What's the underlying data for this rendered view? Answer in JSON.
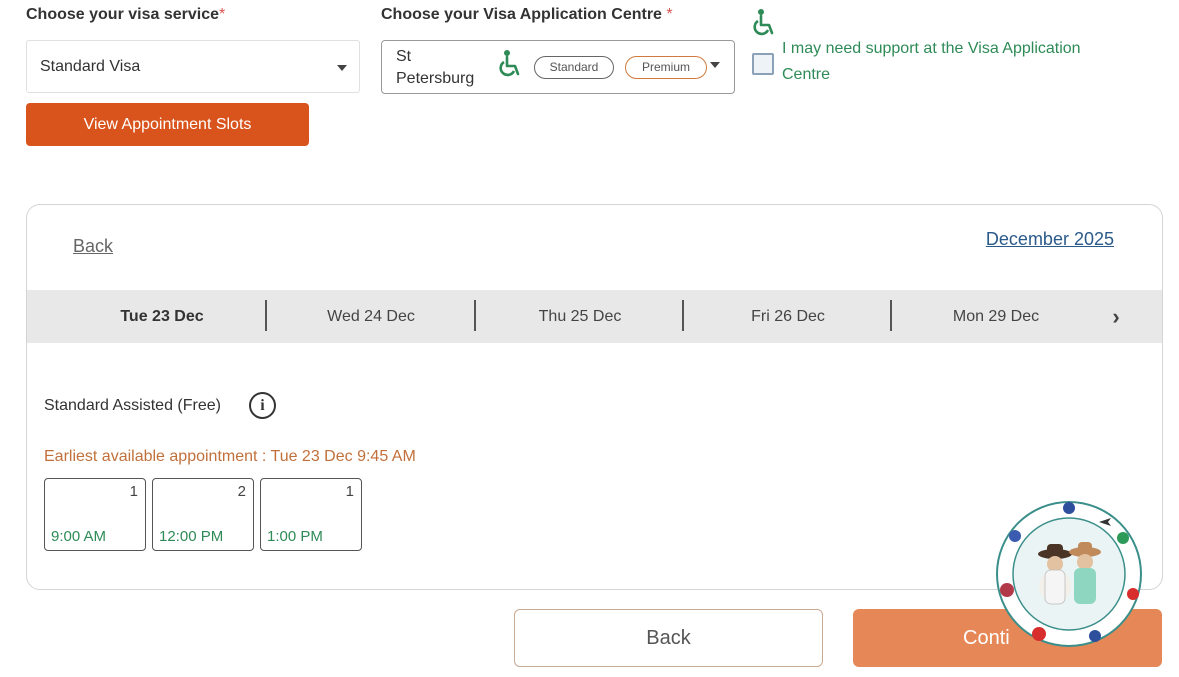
{
  "form": {
    "visa_label": "Choose your visa service",
    "visa_required": "*",
    "visa_value": "Standard Visa",
    "centre_label": "Choose your Visa Application Centre",
    "centre_required": "*",
    "centre_value": "St Petersburg",
    "pill_standard": "Standard",
    "pill_premium": "Premium",
    "support_text": "I may need support at the Visa Application Centre",
    "support_checked": false,
    "view_slots_label": "View Appointment Slots"
  },
  "calendar": {
    "back_label": "Back",
    "month_label": "December 2025",
    "dates": [
      {
        "label": "Tue 23 Dec",
        "active": true
      },
      {
        "label": "Wed 24 Dec",
        "active": false
      },
      {
        "label": "Thu 25 Dec",
        "active": false
      },
      {
        "label": "Fri 26 Dec",
        "active": false
      },
      {
        "label": "Mon 29 Dec",
        "active": false
      }
    ],
    "service_label": "Standard Assisted (Free)",
    "earliest_text": "Earliest available appointment : Tue 23 Dec 9:45 AM",
    "slots": [
      {
        "count": "1",
        "time": "9:00 AM"
      },
      {
        "count": "2",
        "time": "12:00 PM"
      },
      {
        "count": "1",
        "time": "1:00 PM"
      }
    ]
  },
  "footer": {
    "back_label": "Back",
    "continue_label": "Conti"
  },
  "colors": {
    "accent": "#d8541c",
    "continue_bg": "#e58757",
    "green": "#2e8b57"
  },
  "icons": {
    "dropdown": "chevron-down-icon",
    "accessibility": "wheelchair-icon",
    "info": "info-icon",
    "next": "chevron-right-icon"
  }
}
